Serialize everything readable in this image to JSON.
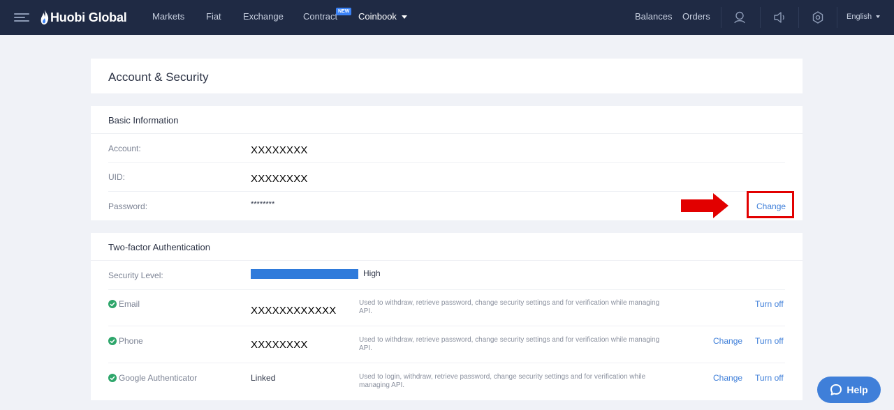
{
  "nav": {
    "brand": "Huobi Global",
    "items": [
      {
        "label": "Markets"
      },
      {
        "label": "Fiat"
      },
      {
        "label": "Exchange"
      },
      {
        "label": "Contract"
      },
      {
        "label": "Coinbook"
      }
    ],
    "contract_badge": "NEW",
    "balances": "Balances",
    "orders": "Orders",
    "language": "English",
    "icons": [
      "menu-icon",
      "user-icon",
      "speaker-icon",
      "gear-icon"
    ]
  },
  "page": {
    "title": "Account & Security"
  },
  "basic_info": {
    "title": "Basic Information",
    "account_label": "Account:",
    "account_value": "XXXXXXXX",
    "uid_label": "UID:",
    "uid_value": "XXXXXXXX",
    "password_label": "Password:",
    "password_value": "********",
    "password_change": "Change"
  },
  "two_factor": {
    "title": "Two-factor Authentication",
    "level_label": "Security Level:",
    "level_value": "High",
    "level_fraction": 1.0,
    "rows": [
      {
        "name": "Email",
        "value": "XXXXXXXXXXXX",
        "description": "Used to withdraw, retrieve password, change security settings and for verification while managing API.",
        "change": "",
        "turn_off": "Turn off"
      },
      {
        "name": "Phone",
        "value": "XXXXXXXX",
        "description": "Used to withdraw, retrieve password, change security settings and for verification while managing API.",
        "change": "Change",
        "turn_off": "Turn off"
      },
      {
        "name": "Google Authenticator",
        "value": "Linked",
        "description": "Used to login, withdraw, retrieve password, change security settings and for verification while managing API.",
        "change": "Change",
        "turn_off": "Turn off"
      }
    ]
  },
  "help": {
    "label": "Help"
  },
  "colors": {
    "nav_bg": "#1f2a44",
    "accent": "#3f7fd9",
    "success": "#2ea66b",
    "annotation": "#e20000"
  }
}
